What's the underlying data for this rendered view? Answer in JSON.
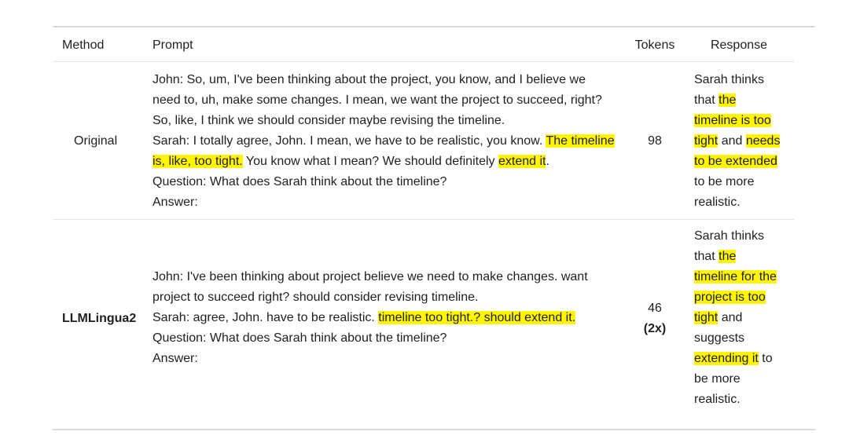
{
  "table": {
    "headers": {
      "method": "Method",
      "prompt": "Prompt",
      "tokens": "Tokens",
      "response": "Response"
    },
    "rows": [
      {
        "method": "Original",
        "prompt_lines": [
          [
            {
              "text": "John: So, um, I've been thinking about the project, you know, and I believe we"
            }
          ],
          [
            {
              "text": "need to, uh, make some changes. I mean, we want the project to succeed, right?"
            }
          ],
          [
            {
              "text": "So, like, I think we should consider maybe revising the timeline."
            }
          ],
          [
            {
              "text": "Sarah: I totally agree, John. I mean, we have to be realistic, you know. "
            },
            {
              "text": "The timeline",
              "hl": true
            }
          ],
          [
            {
              "text": "is, like, too tight.",
              "hl": true
            },
            {
              "text": " You know what I mean? We should definitely "
            },
            {
              "text": "extend it",
              "hl": true
            },
            {
              "text": "."
            }
          ],
          [
            {
              "text": "Question: What does Sarah think about the timeline?"
            }
          ],
          [
            {
              "text": "Answer:"
            }
          ]
        ],
        "tokens": "98",
        "ratio": "",
        "response_lines": [
          [
            {
              "text": "Sarah thinks"
            }
          ],
          [
            {
              "text": "that "
            },
            {
              "text": "the",
              "hl": true
            }
          ],
          [
            {
              "text": "timeline is too",
              "hl": true
            }
          ],
          [
            {
              "text": "tight",
              "hl": true
            },
            {
              "text": " and "
            },
            {
              "text": "needs",
              "hl": true
            }
          ],
          [
            {
              "text": "to be extended",
              "hl": true
            }
          ],
          [
            {
              "text": "to be more"
            }
          ],
          [
            {
              "text": "realistic."
            }
          ]
        ]
      },
      {
        "method": "LLMLingua2",
        "prompt_lines": [
          [
            {
              "text": "John: I've been thinking about project believe we need to make changes. want"
            }
          ],
          [
            {
              "text": "project to succeed right? should consider revising timeline."
            }
          ],
          [
            {
              "text": "Sarah: agree, John. have to be realistic. "
            },
            {
              "text": "timeline too tight.? should extend it.",
              "hl": true
            }
          ],
          [
            {
              "text": "Question: What does Sarah think about the timeline?"
            }
          ],
          [
            {
              "text": "Answer:"
            }
          ]
        ],
        "tokens": "46",
        "ratio": "(2x)",
        "response_lines": [
          [
            {
              "text": "Sarah thinks"
            }
          ],
          [
            {
              "text": "that "
            },
            {
              "text": "the",
              "hl": true
            }
          ],
          [
            {
              "text": "timeline for the",
              "hl": true
            }
          ],
          [
            {
              "text": "project is too",
              "hl": true
            }
          ],
          [
            {
              "text": "tight",
              "hl": true
            },
            {
              "text": " and"
            }
          ],
          [
            {
              "text": "suggests"
            }
          ],
          [
            {
              "text": "extending it",
              "hl": true
            },
            {
              "text": " to"
            }
          ],
          [
            {
              "text": "be more"
            }
          ],
          [
            {
              "text": "realistic."
            }
          ]
        ]
      }
    ]
  }
}
